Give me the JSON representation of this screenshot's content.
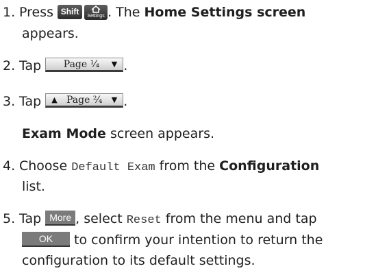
{
  "steps": [
    {
      "num": "1.",
      "pre": "Press",
      "keys": [
        "Shift",
        "Settings"
      ],
      "mid": ". The",
      "bold": "Home Settings screen",
      "cont": "appears."
    },
    {
      "num": "2.",
      "pre": "Tap",
      "softkey": "Page ¹⁄₄",
      "post": "."
    },
    {
      "num": "3.",
      "pre": "Tap",
      "softkey": "Page ²⁄₄",
      "post": ".",
      "note_bold": "Exam Mode",
      "note_rest": "screen appears."
    },
    {
      "num": "4.",
      "pre": "Choose",
      "code": "Default Exam",
      "mid": "from the",
      "bold": "Configuration",
      "cont": "list."
    },
    {
      "num": "5.",
      "pre": "Tap",
      "menu_key": "More",
      "mid": ", select",
      "code": "Reset",
      "after_code": "from the menu and tap",
      "ok_key": "OK",
      "cont": "to confirm your intention to return the",
      "cont2": "configuration to its default settings."
    }
  ]
}
